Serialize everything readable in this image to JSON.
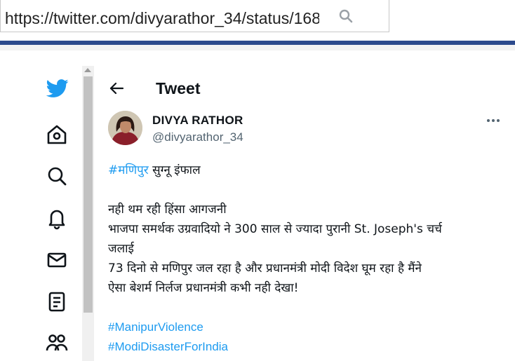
{
  "browser": {
    "url": "https://twitter.com/divyarathor_34/status/168"
  },
  "nav": {
    "icons": [
      "twitter-bird-logo",
      "home-icon",
      "explore-icon",
      "notifications-icon",
      "messages-icon",
      "lists-icon",
      "communities-icon"
    ]
  },
  "header": {
    "title": "Tweet"
  },
  "tweet": {
    "author_name": "DIVYA RATHOR",
    "author_handle": "@divyarathor_34",
    "line1_hashtag": "#मणिपुर",
    "line1_rest": " सुग्नू इंफाल",
    "line2": "नही थम रही हिंसा आगजनी",
    "line3": "भाजपा समर्थक उग्रवादियो ने 300 साल से ज्यादा पुरानी St. Joseph's चर्च",
    "line4": "जलाई",
    "line5": "73 दिनो से मणिपुर जल रहा है और प्रधानमंत्री मोदी विदेश घूम रहा है मैंने",
    "line6": "ऐसा बेशर्म निर्लज प्रधानमंत्री कभी नही देखा!",
    "hashtag1": "#ManipurViolence",
    "hashtag2": "#ModiDisasterForIndia"
  },
  "colors": {
    "twitter_blue": "#1d9bf0",
    "browser_rule": "#2c4a8c",
    "text": "#0f1419",
    "secondary_text": "#536471"
  }
}
